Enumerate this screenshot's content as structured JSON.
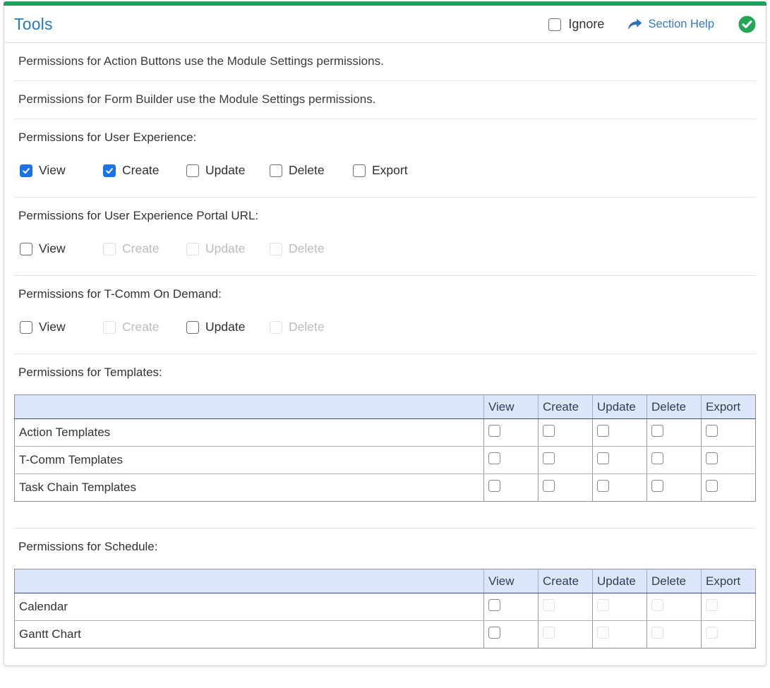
{
  "panel": {
    "title": "Tools",
    "ignore_label": "Ignore",
    "ignore_checked": false,
    "section_help_label": "Section Help",
    "status_icon": "check-circle"
  },
  "colors": {
    "accent_green": "#18a45c",
    "title_blue": "#2879bd",
    "link_blue": "#3878c2",
    "check_blue": "#1a73e8",
    "status_green": "#21a757",
    "table_header_bg": "#dce8f9",
    "table_header_text": "#2c3e5d"
  },
  "sections": [
    {
      "type": "note",
      "text": "Permissions for Action Buttons use the Module Settings permissions."
    },
    {
      "type": "note",
      "text": "Permissions for Form Builder use the Module Settings permissions."
    },
    {
      "type": "checkboxes",
      "label": "Permissions for User Experience:",
      "options": [
        {
          "label": "View",
          "checked": true,
          "disabled": false
        },
        {
          "label": "Create",
          "checked": true,
          "disabled": false
        },
        {
          "label": "Update",
          "checked": false,
          "disabled": false
        },
        {
          "label": "Delete",
          "checked": false,
          "disabled": false
        },
        {
          "label": "Export",
          "checked": false,
          "disabled": false
        }
      ]
    },
    {
      "type": "checkboxes",
      "label": "Permissions for User Experience Portal URL:",
      "options": [
        {
          "label": "View",
          "checked": false,
          "disabled": false
        },
        {
          "label": "Create",
          "checked": false,
          "disabled": true
        },
        {
          "label": "Update",
          "checked": false,
          "disabled": true
        },
        {
          "label": "Delete",
          "checked": false,
          "disabled": true
        }
      ]
    },
    {
      "type": "checkboxes",
      "label": "Permissions for T-Comm On Demand:",
      "options": [
        {
          "label": "View",
          "checked": false,
          "disabled": false
        },
        {
          "label": "Create",
          "checked": false,
          "disabled": true
        },
        {
          "label": "Update",
          "checked": false,
          "disabled": false
        },
        {
          "label": "Delete",
          "checked": false,
          "disabled": true
        }
      ]
    },
    {
      "type": "table",
      "key": "templates",
      "label": "Permissions for Templates:",
      "columns": [
        "View",
        "Create",
        "Update",
        "Delete",
        "Export"
      ],
      "rows": [
        {
          "name": "Action Templates",
          "cells": [
            {
              "checked": false,
              "disabled": false
            },
            {
              "checked": false,
              "disabled": false
            },
            {
              "checked": false,
              "disabled": false
            },
            {
              "checked": false,
              "disabled": false
            },
            {
              "checked": false,
              "disabled": false
            }
          ]
        },
        {
          "name": "T-Comm Templates",
          "cells": [
            {
              "checked": false,
              "disabled": false
            },
            {
              "checked": false,
              "disabled": false
            },
            {
              "checked": false,
              "disabled": false
            },
            {
              "checked": false,
              "disabled": false
            },
            {
              "checked": false,
              "disabled": false
            }
          ]
        },
        {
          "name": "Task Chain Templates",
          "cells": [
            {
              "checked": false,
              "disabled": false
            },
            {
              "checked": false,
              "disabled": false
            },
            {
              "checked": false,
              "disabled": false
            },
            {
              "checked": false,
              "disabled": false
            },
            {
              "checked": false,
              "disabled": false
            }
          ]
        }
      ]
    },
    {
      "type": "table",
      "key": "schedule",
      "label": "Permissions for Schedule:",
      "columns": [
        "View",
        "Create",
        "Update",
        "Delete",
        "Export"
      ],
      "rows": [
        {
          "name": "Calendar",
          "cells": [
            {
              "checked": false,
              "disabled": false
            },
            {
              "checked": false,
              "disabled": true
            },
            {
              "checked": false,
              "disabled": true
            },
            {
              "checked": false,
              "disabled": true
            },
            {
              "checked": false,
              "disabled": true
            }
          ]
        },
        {
          "name": "Gantt Chart",
          "cells": [
            {
              "checked": false,
              "disabled": false
            },
            {
              "checked": false,
              "disabled": true
            },
            {
              "checked": false,
              "disabled": true
            },
            {
              "checked": false,
              "disabled": true
            },
            {
              "checked": false,
              "disabled": true
            }
          ]
        }
      ]
    }
  ]
}
